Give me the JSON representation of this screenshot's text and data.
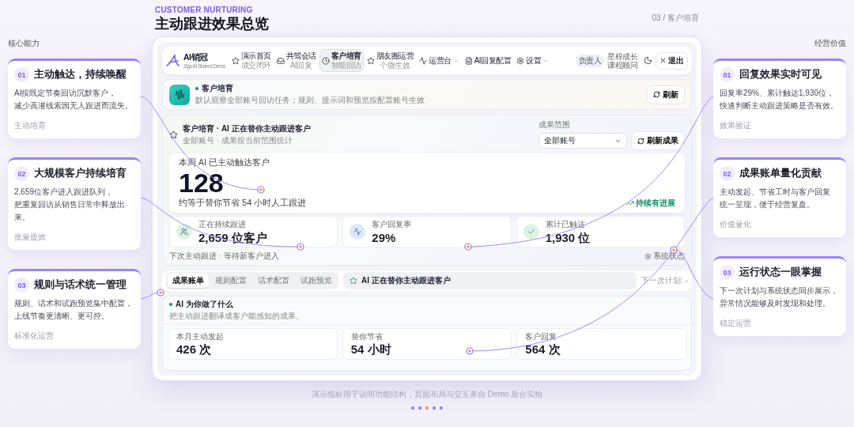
{
  "header": {
    "eyebrow": "CUSTOMER NURTURING",
    "title": "主动跟进效果总览",
    "page_label": "03 / 客户培育"
  },
  "left": {
    "heading": "核心能力",
    "cards": [
      {
        "number": "01",
        "title": "主动触达，持续唤醒",
        "lines": [
          "AI按既定节奏回访沉默客户，",
          "减少高潜线索因无人跟进而流失。"
        ],
        "tag": "主动培育"
      },
      {
        "number": "02",
        "title": "大规模客户持续培育",
        "lines": [
          "2,659位客户进入跟进队列，",
          "把重复回访从销售日常中释放出来。"
        ],
        "tag": "批量提效"
      },
      {
        "number": "03",
        "title": "规则与话术统一管理",
        "lines": [
          "规则、话术和试跑预览集中配置，",
          "上线节奏更清晰、更可控。"
        ],
        "tag": "标准化运营"
      }
    ]
  },
  "right": {
    "heading": "经营价值",
    "cards": [
      {
        "number": "01",
        "title": "回复效果实时可见",
        "lines": [
          "回复率29%、累计触达1,930位，",
          "快速判断主动跟进策略是否有效。"
        ],
        "tag": "效果验证"
      },
      {
        "number": "02",
        "title": "成果账单量化贡献",
        "lines": [
          "主动发起、节省工时与客户回复",
          "统一呈现，便于经营复盘。"
        ],
        "tag": "价值量化"
      },
      {
        "number": "03",
        "title": "运行状态一眼掌握",
        "lines": [
          "下一次计划与系统状态同步展示，",
          "异常情况能够及时发现和处理。"
        ],
        "tag": "稳定运营"
      }
    ]
  },
  "app": {
    "nav": {
      "brand": "AI销冠",
      "brand_sub": "Zigo AI Shared Demo",
      "items": [
        {
          "label": "演示首页",
          "sub": "成交闭环",
          "selected": false,
          "has_menu": false
        },
        {
          "label": "共驾会话",
          "sub": "AI回复",
          "selected": false,
          "has_menu": false
        },
        {
          "label": "客户培育",
          "sub": "智能回访",
          "selected": true,
          "has_menu": false
        },
        {
          "label": "朋友圈运营",
          "sub": "个微生效",
          "selected": false,
          "has_menu": false
        },
        {
          "label": "运营台",
          "selected": false,
          "has_menu": true
        },
        {
          "label": "AI回复配置",
          "selected": false,
          "has_menu": false
        },
        {
          "label": "设置",
          "selected": false,
          "has_menu": true
        }
      ],
      "role": "负责人",
      "user": "星梓成长课程顾问",
      "logout": "退出"
    },
    "page_header": {
      "title": "客户培育",
      "subtitle": "默认观察全部账号回访任务；规则、提示词和预览按配置账号生效",
      "button": "刷新"
    },
    "main": {
      "title": "客户培育 · AI 正在替你主动跟进客户",
      "subtitle": "全部账号 · 成果按当前范围统计",
      "scope_label": "成果范围",
      "scope_value": "全部账号",
      "refresh": "刷新成果",
      "hero": {
        "label": "本周 AI 已主动触达客户",
        "value": "128",
        "note": "约等于替你节省 54 小时人工跟进",
        "trend": "持续有进展"
      },
      "stats": [
        {
          "label": "正在持续跟进",
          "value": "2,659 位客户",
          "color": "#dcf2e3"
        },
        {
          "label": "客户回复率",
          "value": "29%",
          "color": "#dfe8fa"
        },
        {
          "label": "累计已触达",
          "value": "1,930 位",
          "color": "#dcf2e3"
        }
      ],
      "next": "下次主动跟进 · 等待新客户进入",
      "status": "系统状态"
    },
    "tabs": [
      {
        "label": "成果账单",
        "selected": true
      },
      {
        "label": "规则配置",
        "selected": false
      },
      {
        "label": "话术配置",
        "selected": false
      },
      {
        "label": "试跑预览",
        "selected": false
      }
    ],
    "banner": "AI 正在替你主动跟进客户",
    "next_plan": "下一次计划: -",
    "results": {
      "title": "AI 为你做了什么",
      "subtitle": "把主动跟进翻译成客户能感知的成果。",
      "metrics": [
        {
          "label": "本月主动发起",
          "value": "426 次"
        },
        {
          "label": "替你节省",
          "value": "54 小时"
        },
        {
          "label": "客户回复",
          "value": "564 次"
        }
      ]
    }
  },
  "footer": {
    "caption": "演示指标用于说明功能结构，页面布局与交互来自 Demo 后台实拍",
    "pagination": [
      {
        "selected": false
      },
      {
        "selected": false
      },
      {
        "selected": true
      },
      {
        "selected": false
      },
      {
        "selected": false
      }
    ]
  }
}
